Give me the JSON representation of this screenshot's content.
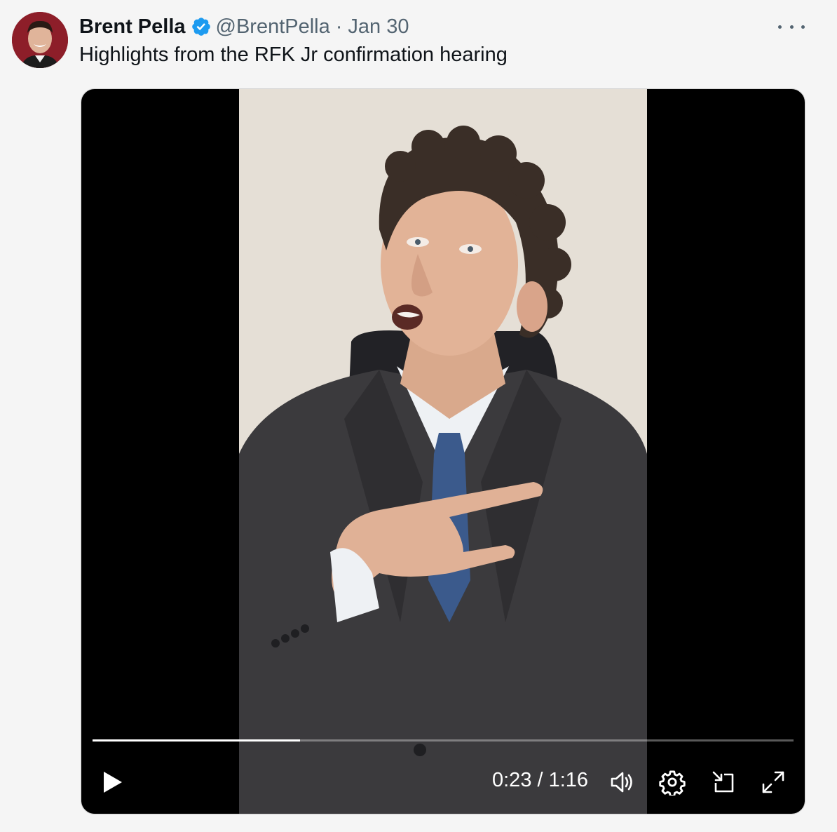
{
  "tweet": {
    "author_name": "Brent Pella",
    "handle": "@BrentPella",
    "separator": "·",
    "date": "Jan 30",
    "text": "Highlights from the RFK Jr confirmation hearing",
    "verified": true
  },
  "video": {
    "current_time": "0:23",
    "duration": "1:16",
    "time_display": "0:23 / 1:16",
    "progress_fraction": 0.296,
    "state": "paused"
  },
  "icons": {
    "more": "more-horizontal-icon",
    "verified": "verified-badge-icon",
    "play": "play-icon",
    "volume": "volume-icon",
    "settings": "gear-icon",
    "pip": "picture-in-picture-icon",
    "fullscreen": "fullscreen-icon"
  },
  "colors": {
    "verified_blue": "#1d9bf0",
    "secondary_text": "#536471",
    "primary_text": "#0f1419"
  }
}
